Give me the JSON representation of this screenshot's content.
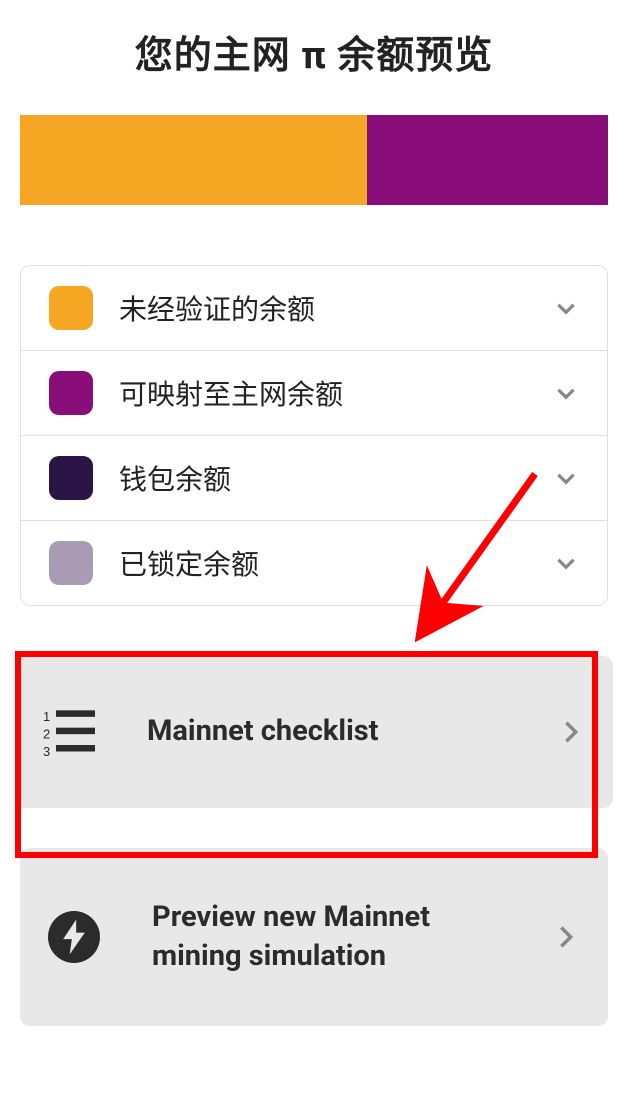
{
  "title": "您的主网 π 余额预览",
  "progress": {
    "colors": {
      "segment1": "#f5a623",
      "segment2": "#8a0e7a"
    }
  },
  "legend": {
    "items": [
      {
        "label": "未经验证的余额",
        "swatch": "orange"
      },
      {
        "label": "可映射至主网余额",
        "swatch": "purple"
      },
      {
        "label": "钱包余额",
        "swatch": "dark"
      },
      {
        "label": "已锁定余额",
        "swatch": "gray"
      }
    ]
  },
  "actions": {
    "checklist": {
      "label": "Mainnet checklist"
    },
    "simulation": {
      "label": "Preview new Mainnet mining simulation"
    }
  }
}
